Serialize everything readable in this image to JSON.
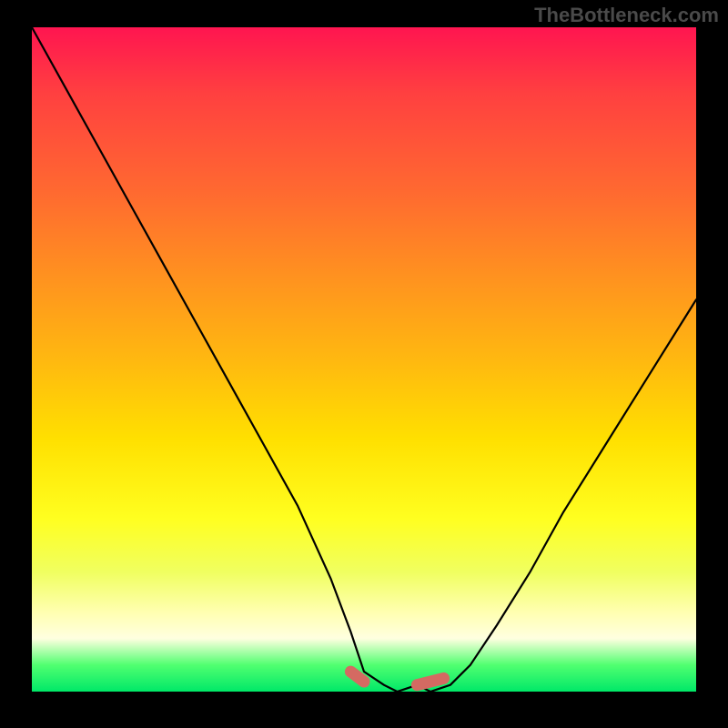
{
  "watermark": "TheBottleneck.com",
  "chart_data": {
    "type": "line",
    "title": "",
    "xlabel": "",
    "ylabel": "",
    "xlim": [
      0,
      100
    ],
    "ylim": [
      0,
      100
    ],
    "grid": false,
    "series": [
      {
        "name": "curve",
        "x": [
          0,
          5,
          10,
          15,
          20,
          25,
          30,
          35,
          40,
          45,
          48,
          50,
          53,
          55,
          58,
          60,
          63,
          66,
          70,
          75,
          80,
          85,
          90,
          95,
          100
        ],
        "y": [
          100,
          91,
          82,
          73,
          64,
          55,
          46,
          37,
          28,
          17,
          9,
          3,
          1,
          0,
          1,
          0,
          1,
          4,
          10,
          18,
          27,
          35,
          43,
          51,
          59
        ]
      }
    ],
    "markers": [
      {
        "name": "trough-left-edge",
        "x": 48,
        "y": 3,
        "color": "#d46a62"
      },
      {
        "name": "trough-left-bottom",
        "x": 50,
        "y": 1.5,
        "color": "#d46a62"
      },
      {
        "name": "trough-right-start",
        "x": 58,
        "y": 1,
        "color": "#d46a62"
      },
      {
        "name": "trough-right-end",
        "x": 62,
        "y": 2,
        "color": "#d46a62"
      }
    ],
    "background_gradient": {
      "top": "#ff1550",
      "bottom": "#00e868"
    }
  }
}
